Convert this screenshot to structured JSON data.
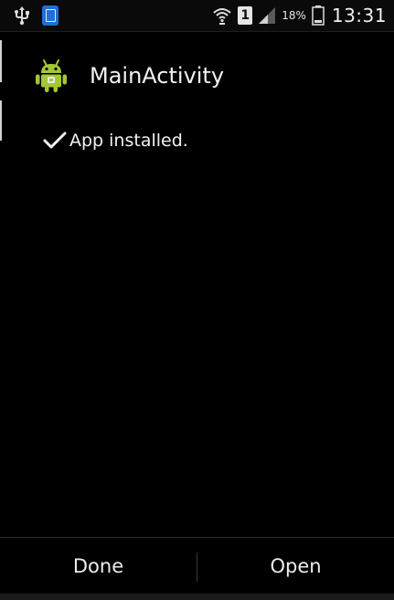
{
  "status_bar": {
    "battery_percent": "18%",
    "sim_slot": "1",
    "time": "13:31",
    "icons": [
      "usb-icon",
      "note-icon",
      "wifi-icon",
      "sim-icon",
      "signal-icon",
      "battery-icon"
    ]
  },
  "header": {
    "title": "MainActivity",
    "icon": "android-icon"
  },
  "message": {
    "text": "App installed.",
    "icon": "check-icon"
  },
  "buttons": {
    "done_label": "Done",
    "open_label": "Open"
  },
  "colors": {
    "background": "#000000",
    "android_green": "#a4c639"
  }
}
